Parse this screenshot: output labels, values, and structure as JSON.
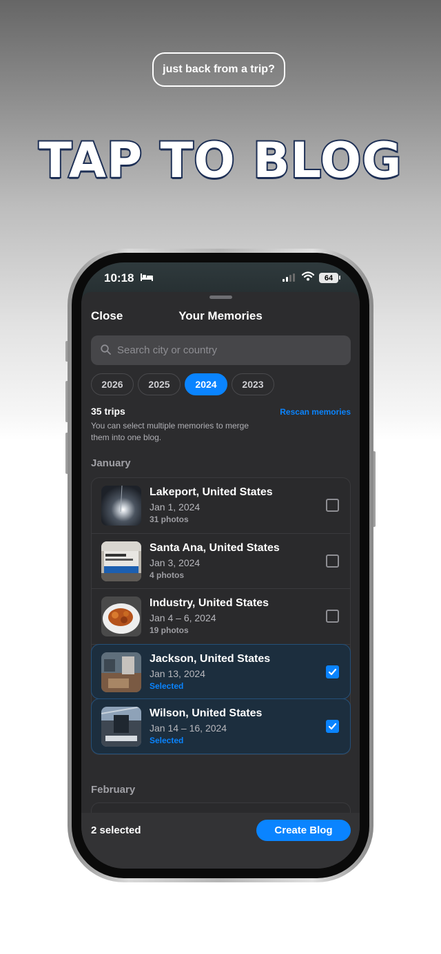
{
  "promo": {
    "pill_text": "just back from a trip?",
    "headline": "TAP TO BLOG"
  },
  "status_bar": {
    "time": "10:18",
    "battery": "64"
  },
  "sheet": {
    "close_label": "Close",
    "title": "Your Memories",
    "search_placeholder": "Search city or country",
    "years": [
      {
        "label": "2026",
        "active": false
      },
      {
        "label": "2025",
        "active": false
      },
      {
        "label": "2024",
        "active": true
      },
      {
        "label": "2023",
        "active": false
      }
    ],
    "trip_count": "35 trips",
    "hint": "You can select multiple memories to merge them into one blog.",
    "rescan_label": "Rescan memories",
    "sections": [
      {
        "month": "January",
        "items": [
          {
            "title": "Lakeport, United States",
            "date": "Jan 1, 2024",
            "sub": "31 photos",
            "selected": false
          },
          {
            "title": "Santa Ana, United States",
            "date": "Jan 3, 2024",
            "sub": "4 photos",
            "selected": false
          },
          {
            "title": "Industry, United States",
            "date": "Jan 4 – 6, 2024",
            "sub": "19 photos",
            "selected": false
          },
          {
            "title": "Jackson, United States",
            "date": "Jan 13, 2024",
            "sub": "Selected",
            "selected": true
          },
          {
            "title": "Wilson, United States",
            "date": "Jan 14 – 16, 2024",
            "sub": "Selected",
            "selected": true
          }
        ]
      },
      {
        "month": "February",
        "items": []
      }
    ],
    "selected_count": "2 selected",
    "create_label": "Create Blog",
    "accent": "#0a84ff"
  }
}
